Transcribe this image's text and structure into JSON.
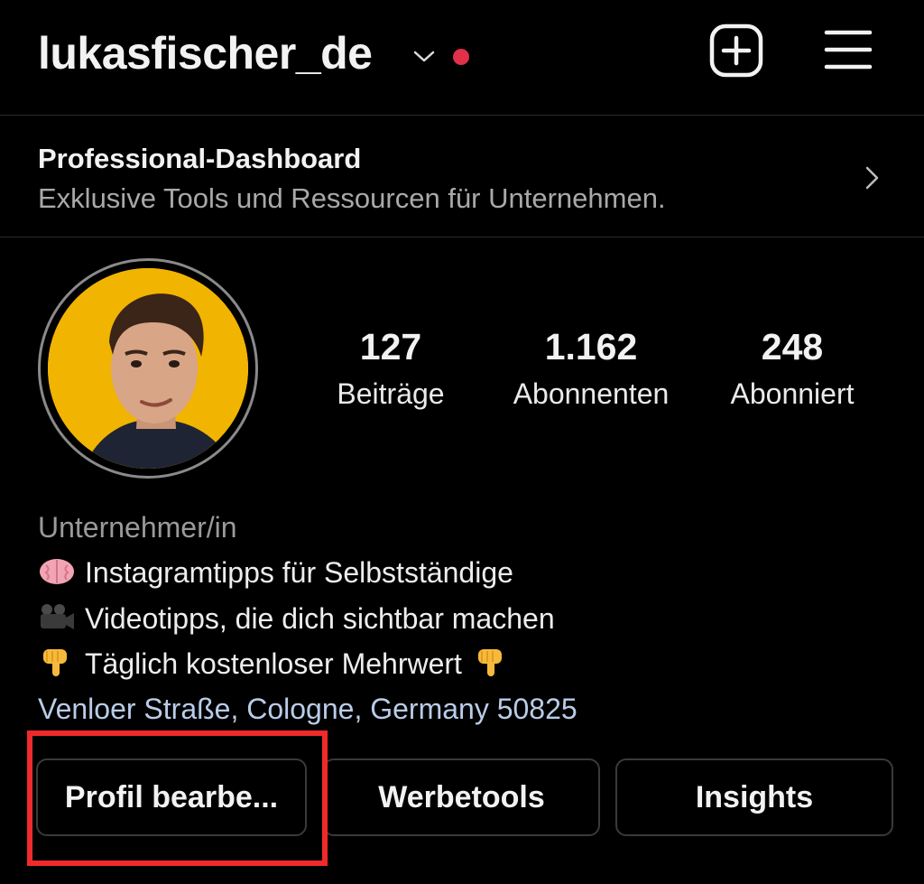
{
  "header": {
    "username": "lukasfischer_de",
    "account_switch_icon": "chevron-down-icon",
    "notification_dot_color": "#e0304a",
    "create_icon": "plus-square-icon",
    "menu_icon": "hamburger-menu-icon"
  },
  "dashboard": {
    "title": "Professional-Dashboard",
    "subtitle": "Exklusive Tools und Ressourcen für Unternehmen.",
    "icon": "chevron-right-icon"
  },
  "profile": {
    "avatar_bg": "#f1b400",
    "stats": [
      {
        "value": "127",
        "label": "Beiträge"
      },
      {
        "value": "1.162",
        "label": "Abonnenten"
      },
      {
        "value": "248",
        "label": "Abonniert"
      }
    ]
  },
  "bio": {
    "category": "Unternehmer/in",
    "lines": [
      {
        "emoji": "brain-emoji",
        "text": "Instagramtipps für Selbstständige"
      },
      {
        "emoji": "movie-camera-emoji",
        "text": "Videotipps, die dich sichtbar machen"
      },
      {
        "emoji": "pointing-down-emoji",
        "text": "Täglich kostenloser Mehrwert"
      }
    ],
    "location": "Venloer Straße, Cologne, Germany 50825"
  },
  "buttons": {
    "edit_profile": "Profil bearbe...",
    "ad_tools": "Werbetools",
    "insights": "Insights"
  },
  "highlight_color": "#f02a2a"
}
